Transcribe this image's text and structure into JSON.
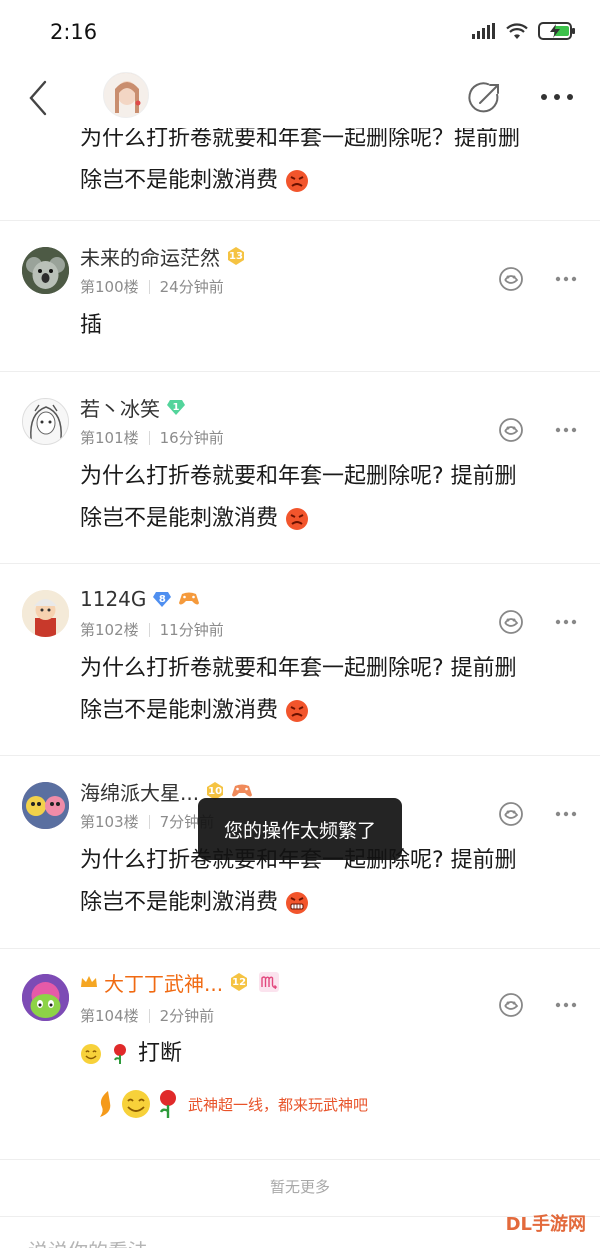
{
  "status_bar": {
    "time": "2:16",
    "icons": [
      "signal-icon",
      "wifi-icon",
      "battery-charging-icon"
    ]
  },
  "nav": {
    "back_icon": "chevron-left-icon",
    "share_icon": "share-icon",
    "more_icon": "more-dots-icon"
  },
  "top_partial": {
    "line1": "为什么打折卷就要和年套一起删除呢？提前删",
    "line2": "除岂不是能刺激消费"
  },
  "comments": [
    {
      "username": "未来的命运茫然",
      "level": "13",
      "floor": "第100楼",
      "time": "24分钟前",
      "text_lines": [
        "插"
      ]
    },
    {
      "username": "若丶冰笑",
      "level": "1",
      "floor": "第101楼",
      "time": "16分钟前",
      "text_lines": [
        "为什么打折卷就要和年套一起删除呢? 提前删",
        "除岂不是能刺激消费"
      ]
    },
    {
      "username": "1124G",
      "level": "8",
      "floor": "第102楼",
      "time": "11分钟前",
      "text_lines": [
        "为什么打折卷就要和年套一起删除呢? 提前删",
        "除岂不是能刺激消费"
      ]
    },
    {
      "username": "海绵派大星...",
      "level": "10",
      "floor": "第103楼",
      "time": "7分钟前",
      "text_lines": [
        "为什么打折卷就要和年套一起删除呢? 提前删",
        "除岂不是能刺激消费"
      ]
    },
    {
      "username": "大丁丁武神...",
      "level": "12",
      "floor": "第104楼",
      "time": "2分钟前",
      "text_lines": [
        "打断"
      ],
      "signature": "武神超一线，都来玩武神吧"
    }
  ],
  "no_more": "暂无更多",
  "comment_input": {
    "placeholder": "说说你的看法"
  },
  "toast": "您的操作太频繁了",
  "watermark": "DL手游网",
  "colors": {
    "accent_orange": "#f06a12",
    "toast_bg": "#111111",
    "divider": "#eeeeee"
  }
}
